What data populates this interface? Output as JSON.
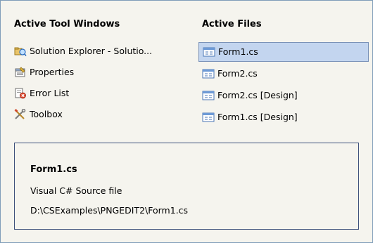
{
  "tool_windows": {
    "heading": "Active Tool Windows",
    "items": [
      {
        "label": "Solution Explorer - Solutio...",
        "icon": "solution-explorer-icon"
      },
      {
        "label": "Properties",
        "icon": "properties-icon"
      },
      {
        "label": "Error List",
        "icon": "error-list-icon"
      },
      {
        "label": "Toolbox",
        "icon": "toolbox-icon"
      }
    ]
  },
  "active_files": {
    "heading": "Active Files",
    "items": [
      {
        "label": "Form1.cs",
        "icon": "form-file-icon",
        "selected": true
      },
      {
        "label": "Form2.cs",
        "icon": "form-file-icon",
        "selected": false
      },
      {
        "label": "Form2.cs [Design]",
        "icon": "form-file-icon",
        "selected": false
      },
      {
        "label": "Form1.cs [Design]",
        "icon": "form-file-icon",
        "selected": false
      }
    ]
  },
  "details": {
    "title": "Form1.cs",
    "description": "Visual C# Source file",
    "path": "D:\\CSExamples\\PNGEDIT2\\Form1.cs"
  },
  "colors": {
    "background": "#f5f4ee",
    "selection_fill": "#c3d5ef",
    "selection_border": "#7a92b8",
    "info_border": "#3c4f7a"
  }
}
